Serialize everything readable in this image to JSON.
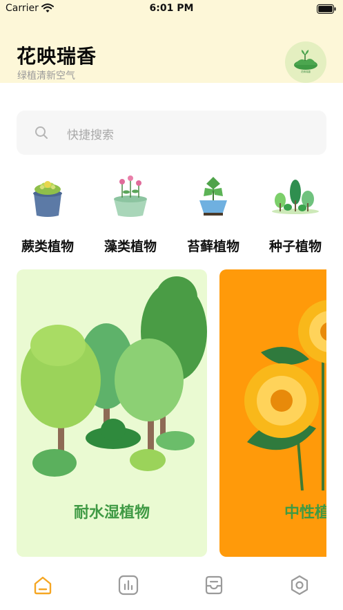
{
  "status_bar": {
    "carrier": "Carrier",
    "time": "6:01 PM",
    "wifi_icon": "wifi-icon",
    "battery_icon": "battery-icon"
  },
  "header": {
    "title": "花映瑞香",
    "subtitle": "绿植清新空气",
    "avatar_caption": "花映瑞香"
  },
  "search": {
    "placeholder": "快捷搜索",
    "icon": "search-icon"
  },
  "categories": [
    {
      "label": "蕨类植物",
      "icon": "succulent-pot-icon"
    },
    {
      "label": "藻类植物",
      "icon": "flower-pot-icon"
    },
    {
      "label": "苔藓植物",
      "icon": "bonsai-icon"
    },
    {
      "label": "种子植物",
      "icon": "trees-icon"
    }
  ],
  "cards": [
    {
      "label": "耐水湿植物",
      "bg_color": "#eafad2",
      "label_color": "#3f9a44",
      "art": "trees-illustration"
    },
    {
      "label": "中性植物",
      "bg_color": "#ff9a0a",
      "label_color": "#3f9a44",
      "art": "chrysanthemum-illustration"
    }
  ],
  "tab_bar": [
    {
      "name": "home",
      "icon": "home-icon",
      "active": true
    },
    {
      "name": "stats",
      "icon": "chart-icon",
      "active": false
    },
    {
      "name": "inbox",
      "icon": "inbox-icon",
      "active": false
    },
    {
      "name": "settings",
      "icon": "settings-icon",
      "active": false
    }
  ],
  "colors": {
    "header_bg": "#fdf7d8",
    "accent": "#f5a623",
    "tab_inactive": "#9a9a9a"
  }
}
